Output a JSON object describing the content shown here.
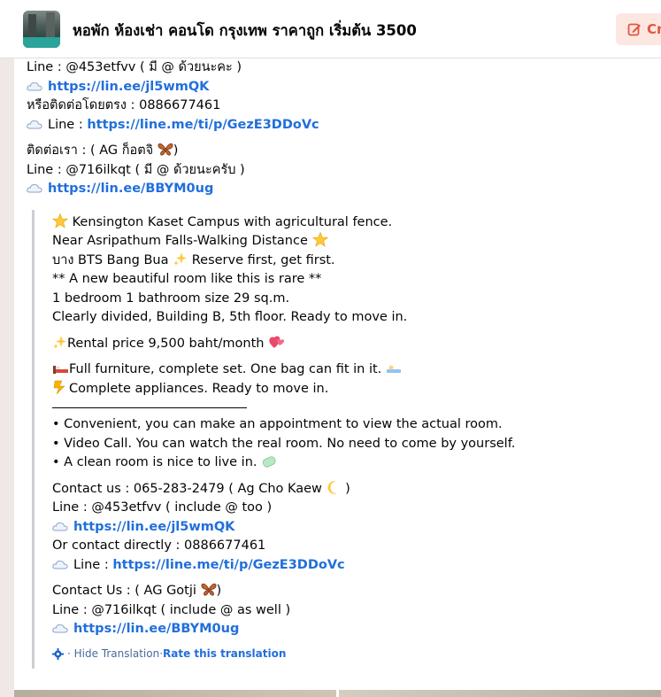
{
  "header": {
    "group_title": "หอพัก ห้องเช่า คอนโด กรุงเทพ ราคาถูก เริ่มต้น 3500",
    "create_label": "Cr"
  },
  "thai": {
    "line1_id": "Line : @453etfvv ( มี @ ด้วยนะคะ )",
    "line1_url": "https://lin.ee/jl5wmQK",
    "direct": "หรือติดต่อโดยตรง : 0886677461",
    "line_prefix": "Line : ",
    "line2_url": "https://line.me/ti/p/GezE3DDoVc",
    "contact2": "ติดต่อเรา : ( AG ก็อตจิ ",
    "contact2_close": ")",
    "line3_id": "Line : @716ilkqt ( มี @ ด้วยนะครับ )",
    "line3_url": "https://lin.ee/BBYM0ug"
  },
  "translation": {
    "l1": " Kensington Kaset Campus with agricultural fence.",
    "l2": "Near Asripathum Falls-Walking Distance ",
    "l3a": "บาง BTS Bang Bua ",
    "l3b": " Reserve first, get first.",
    "l4": "** A new beautiful room like this is rare **",
    "l5": "1 bedroom 1 bathroom size 29 sq.m.",
    "l6": "Clearly divided, Building B, 5th floor. Ready to move in.",
    "rent": "Rental price 9,500 baht/month ",
    "furniture": "Full furniture, complete set. One bag can fit in it. ",
    "appliances": "Complete appliances. Ready to move in.",
    "b1": "• Convenient, you can make an appointment to view the actual room.",
    "b2": "• Video Call. You can watch the real room. No need to come by yourself.",
    "b3": "• A clean room is nice to live in. ",
    "contact1": "Contact us : 065-283-2479 ( Ag Cho Kaew ",
    "contact1_close": " )",
    "line1_id": "Line : @453etfvv ( include @ too )",
    "line1_url": "https://lin.ee/jl5wmQK",
    "direct": "Or contact directly : 0886677461",
    "line_prefix": "Line : ",
    "line2_url": "https://line.me/ti/p/GezE3DDoVc",
    "contact2": "Contact Us : ( AG Gotji ",
    "contact2_close": ")",
    "line3_id": "Line : @716ilkqt ( include @ as well )",
    "line3_url": "https://lin.ee/BBYM0ug",
    "hide_translation": "· Hide Translation",
    "sep": " · ",
    "rate": "Rate this translation"
  },
  "colors": {
    "link": "#216fdb",
    "create_bg": "#fde7e1",
    "create_fg": "#e4553f"
  },
  "icons": [
    "group-avatar",
    "edit-icon",
    "cloud-icon",
    "star-icon",
    "sparkles-icon",
    "heart-icon",
    "bed-icon",
    "lightning-icon",
    "butterfly-icon",
    "moon-icon",
    "soap-icon",
    "gear-icon"
  ]
}
